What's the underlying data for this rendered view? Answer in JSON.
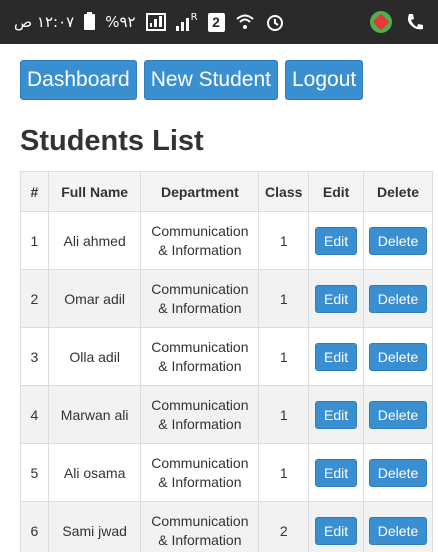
{
  "statusbar": {
    "time": "١٢:٠٧ ص",
    "battery": "%٩٢",
    "sim": "2",
    "roaming": "R"
  },
  "nav": {
    "dashboard": "Dashboard",
    "new_student": "New Student",
    "logout": "Logout"
  },
  "title": "Students List",
  "table": {
    "headers": [
      "#",
      "Full Name",
      "Department",
      "Class",
      "Edit",
      "Delete"
    ],
    "rows": [
      {
        "num": "1",
        "name": "Ali ahmed",
        "dept1": "Communication",
        "dept2": "& Information",
        "class": "1",
        "edit": "Edit",
        "delete": "Delete"
      },
      {
        "num": "2",
        "name": "Omar adil",
        "dept1": "Communication",
        "dept2": "& Information",
        "class": "1",
        "edit": "Edit",
        "delete": "Delete"
      },
      {
        "num": "3",
        "name": "Olla adil",
        "dept1": "Communication",
        "dept2": "& Information",
        "class": "1",
        "edit": "Edit",
        "delete": "Delete"
      },
      {
        "num": "4",
        "name": "Marwan ali",
        "dept1": "Communication",
        "dept2": "& Information",
        "class": "1",
        "edit": "Edit",
        "delete": "Delete"
      },
      {
        "num": "5",
        "name": "Ali osama",
        "dept1": "Communication",
        "dept2": "& Information",
        "class": "1",
        "edit": "Edit",
        "delete": "Delete"
      },
      {
        "num": "6",
        "name": "Sami jwad",
        "dept1": "Communication",
        "dept2": "& Information",
        "class": "2",
        "edit": "Edit",
        "delete": "Delete"
      }
    ]
  },
  "colors": {
    "primary": "#3a8fd0",
    "statusbar": "#2a2a2a",
    "row_stripe": "#f2f2f2"
  }
}
